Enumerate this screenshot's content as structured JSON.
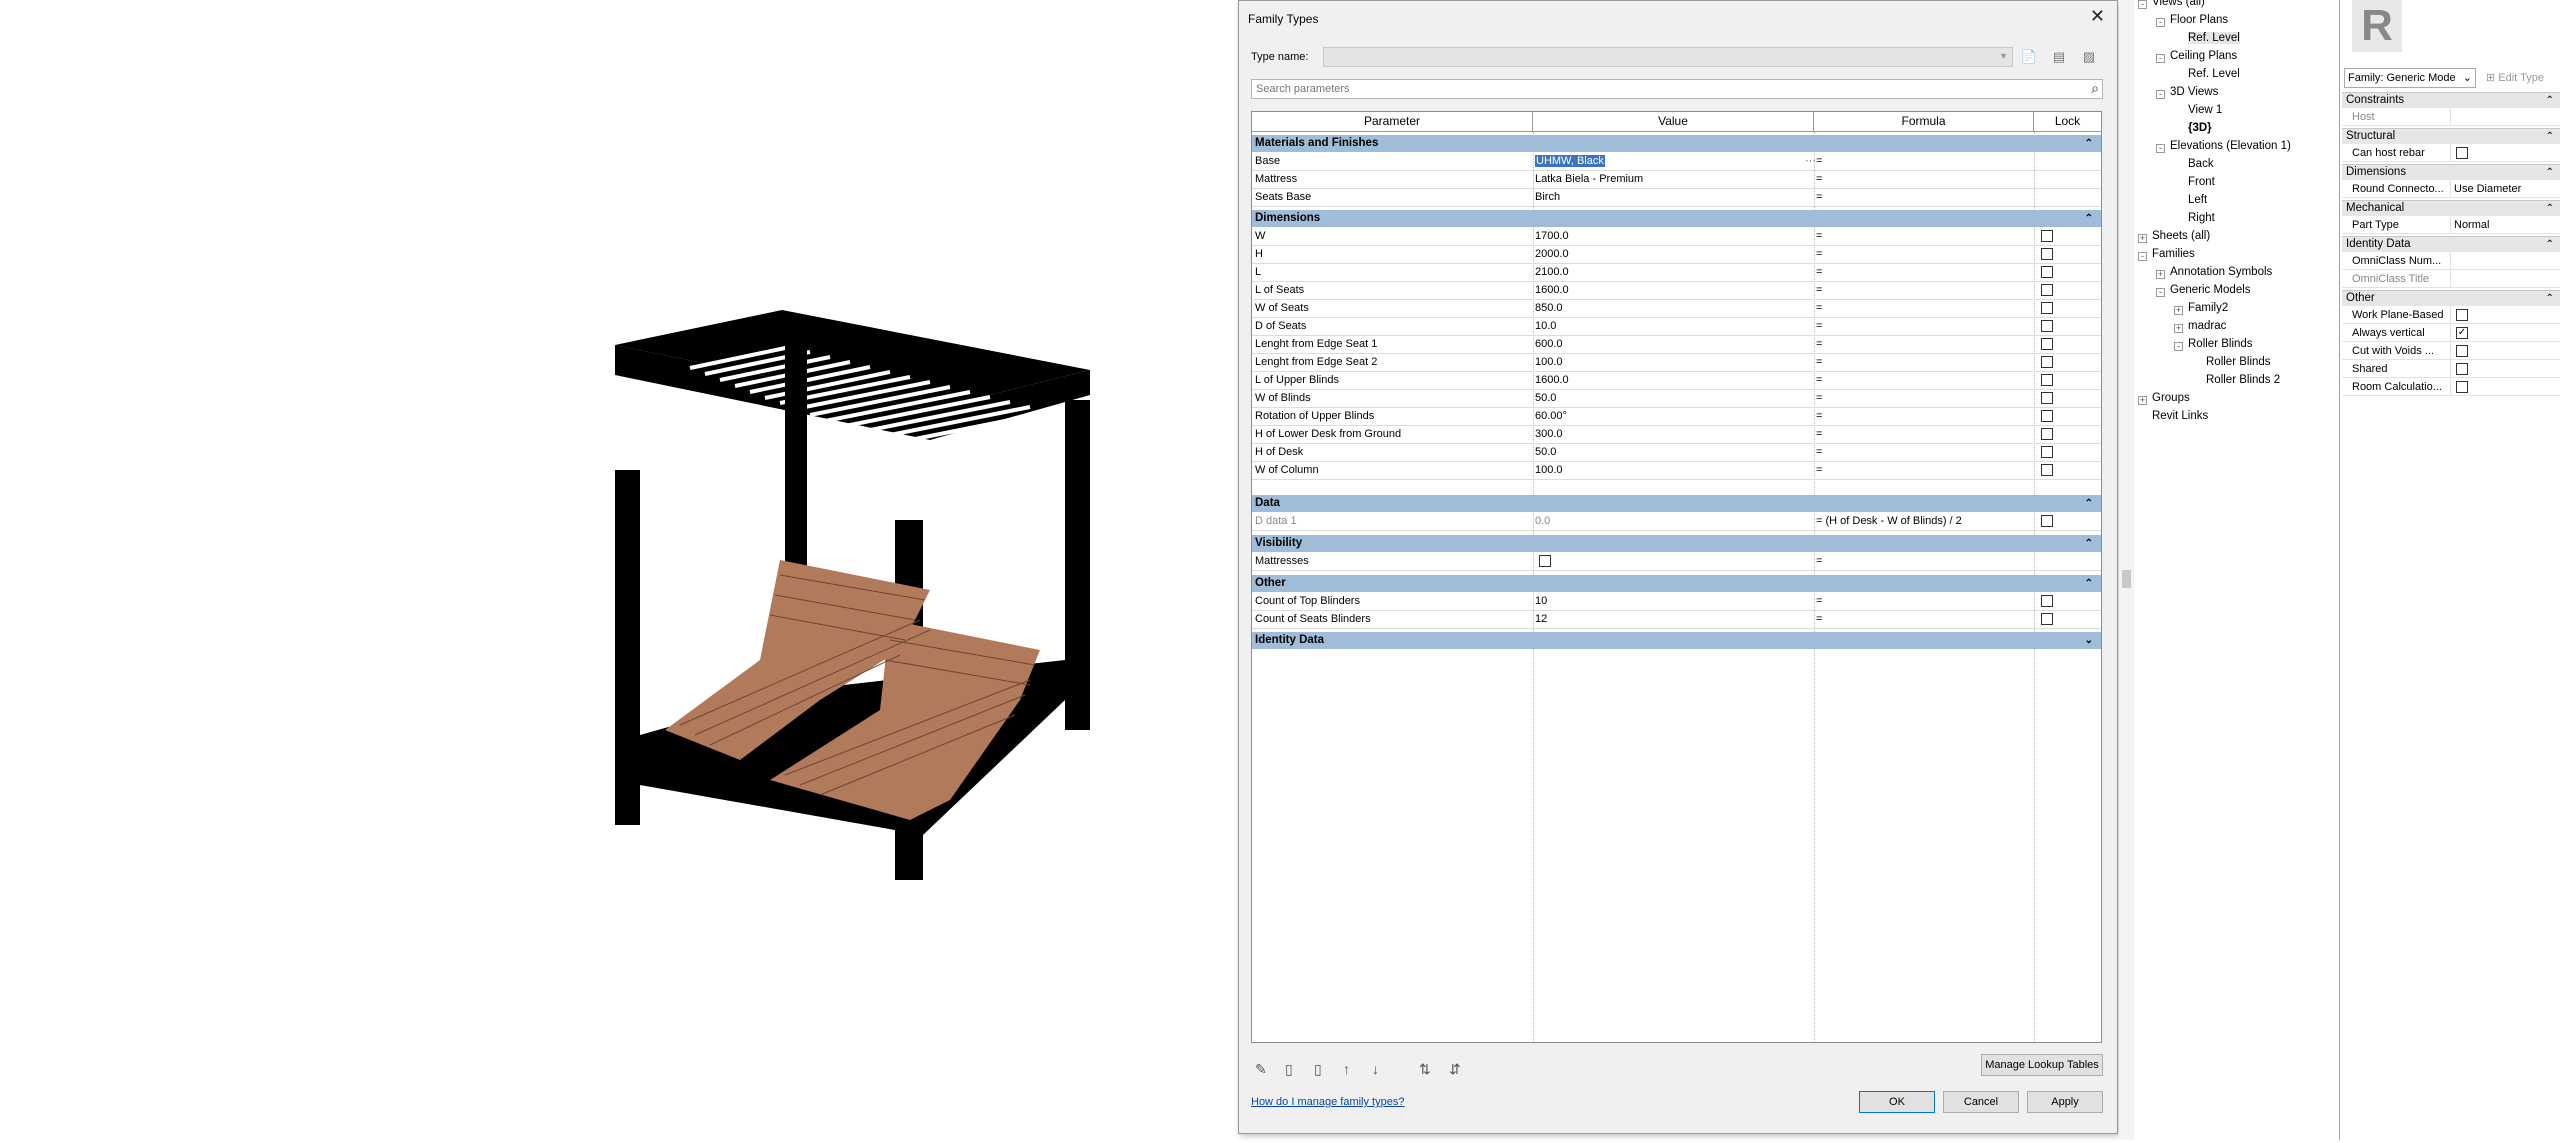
{
  "dialog": {
    "title": "Family Types",
    "type_name_label": "Type name:",
    "search_placeholder": "Search parameters",
    "columns": [
      "Parameter",
      "Value",
      "Formula",
      "Lock"
    ],
    "groups": {
      "materials": "Materials and Finishes",
      "dimensions": "Dimensions",
      "data": "Data",
      "visibility": "Visibility",
      "other": "Other",
      "identity": "Identity Data"
    },
    "materials_rows": [
      {
        "p": "Base",
        "v": "UHMW, Black",
        "f": "="
      },
      {
        "p": "Mattress",
        "v": "Latka Biela - Premium",
        "f": "="
      },
      {
        "p": "Seats Base",
        "v": "Birch",
        "f": "="
      }
    ],
    "dimension_rows": [
      {
        "p": "W",
        "v": "1700.0",
        "f": "="
      },
      {
        "p": "H",
        "v": "2000.0",
        "f": "="
      },
      {
        "p": "L",
        "v": "2100.0",
        "f": "="
      },
      {
        "p": "L of Seats",
        "v": "1600.0",
        "f": "="
      },
      {
        "p": "W of Seats",
        "v": "850.0",
        "f": "="
      },
      {
        "p": "D of Seats",
        "v": "10.0",
        "f": "="
      },
      {
        "p": "Lenght from Edge Seat 1",
        "v": "600.0",
        "f": "="
      },
      {
        "p": "Lenght from Edge Seat 2",
        "v": "100.0",
        "f": "="
      },
      {
        "p": "L of Upper Blinds",
        "v": "1600.0",
        "f": "="
      },
      {
        "p": "W of Blinds",
        "v": "50.0",
        "f": "="
      },
      {
        "p": "Rotation of Upper Blinds",
        "v": "60.00°",
        "f": "="
      },
      {
        "p": "H of Lower Desk from Ground",
        "v": "300.0",
        "f": "="
      },
      {
        "p": "H of Desk",
        "v": "50.0",
        "f": "="
      },
      {
        "p": "W of Column",
        "v": "100.0",
        "f": "="
      }
    ],
    "data_rows": [
      {
        "p": "D data 1",
        "v": "0.0",
        "f": "= (H of Desk - W of Blinds) / 2"
      }
    ],
    "visibility_rows": [
      {
        "p": "Mattresses",
        "f": "="
      }
    ],
    "other_rows": [
      {
        "p": "Count of Top Blinders",
        "v": "10",
        "f": "="
      },
      {
        "p": "Count of Seats Blinders",
        "v": "12",
        "f": "="
      }
    ],
    "help_link": "How do I manage family types?",
    "manage_lookup": "Manage Lookup Tables",
    "ok": "OK",
    "cancel": "Cancel",
    "apply": "Apply"
  },
  "browser": {
    "items": [
      {
        "label": "Views (all)"
      },
      {
        "label": "Floor Plans"
      },
      {
        "label": "Ref. Level"
      },
      {
        "label": "Ceiling Plans"
      },
      {
        "label": "Ref. Level"
      },
      {
        "label": "3D Views"
      },
      {
        "label": "View 1"
      },
      {
        "label": "{3D}"
      },
      {
        "label": "Elevations (Elevation 1)"
      },
      {
        "label": "Back"
      },
      {
        "label": "Front"
      },
      {
        "label": "Left"
      },
      {
        "label": "Right"
      },
      {
        "label": "Sheets (all)"
      },
      {
        "label": "Families"
      },
      {
        "label": "Annotation Symbols"
      },
      {
        "label": "Generic Models"
      },
      {
        "label": "Family2"
      },
      {
        "label": "madrac"
      },
      {
        "label": "Roller Blinds"
      },
      {
        "label": "Roller Blinds"
      },
      {
        "label": "Roller Blinds 2"
      },
      {
        "label": "Groups"
      },
      {
        "label": "Revit Links"
      }
    ]
  },
  "properties": {
    "family_selector": "Family: Generic Mode",
    "edit_type": "Edit Type",
    "groups": {
      "constraints": "Constraints",
      "structural": "Structural",
      "dimensions": "Dimensions",
      "mechanical": "Mechanical",
      "identity": "Identity Data",
      "other": "Other"
    },
    "host": "Host",
    "can_host_rebar": "Can host rebar",
    "round_connector_k": "Round Connecto...",
    "round_connector_v": "Use Diameter",
    "part_type_k": "Part Type",
    "part_type_v": "Normal",
    "omni_num": "OmniClass Num...",
    "omni_title": "OmniClass Title",
    "work_plane": "Work Plane-Based",
    "always_vertical": "Always vertical",
    "cut_voids": "Cut with Voids ...",
    "shared": "Shared",
    "room_calc": "Room Calculatio..."
  }
}
